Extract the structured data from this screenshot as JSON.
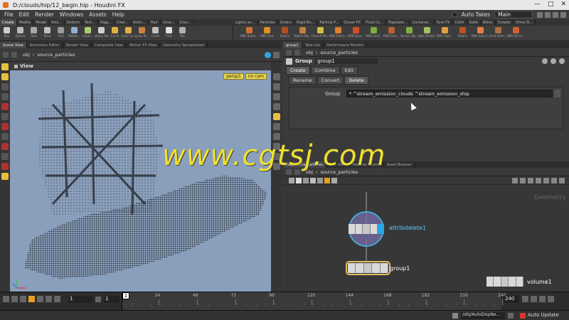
{
  "window": {
    "title": "D:/clouds/hip/12_begin.hip - Houdini FX",
    "controls": [
      "—",
      "□",
      "✕"
    ]
  },
  "menu": {
    "items": [
      "File",
      "Edit",
      "Render",
      "Windows",
      "Assets",
      "Help"
    ],
    "auto_takes": "Auto Takes",
    "desktop": "Main"
  },
  "shelf_tabs_left": [
    "Create",
    "Modify",
    "Model",
    "Poly...",
    "Deform",
    "Text...",
    "Rigg...",
    "Char...",
    "Anim...",
    "Hair",
    "Groo...",
    "Clou..."
  ],
  "shelf_tabs_right": [
    "Lights an...",
    "Particles",
    "Grains",
    "Rigid Bo...",
    "Particle F...",
    "Ocean FX",
    "Fluid Co...",
    "Populate...",
    "Containe...",
    "Pyro FX",
    "Cloth",
    "Solid",
    "Wires",
    "Crowds",
    "Drive Si..."
  ],
  "shelf_tools_left": [
    "Box",
    "Sphere",
    "Tube",
    "Torus",
    "Grid",
    "Metab...",
    "LSyst...",
    "Platonic Sol...",
    "Curve",
    "Draw Cur...",
    "Spray Pa...",
    "Circle",
    "Font",
    "File"
  ],
  "shelf_tools_right": [
    "RBD Bullet...",
    "RBD Glue",
    "Debris",
    "Debris Obj...",
    "Ground Pla...",
    "RBD Fractu...",
    "RBD Glue...",
    "RBD Conf...",
    "RBD Grav...",
    "Terrain Obj...",
    "Make Breakt...",
    "RBD Impa...",
    "Debris",
    "RBD Auto F...",
    "Unst Anim...",
    "RBD Fill Co..."
  ],
  "left_pane": {
    "tabs": [
      "Scene View",
      "Animation Editor",
      "Render View",
      "Composite View",
      "Motion FX View",
      "Geometry Spreadsheet"
    ],
    "path": [
      "obj",
      "source_particles"
    ],
    "view_title": "View",
    "camera": "persp1",
    "cam_select": "no cam"
  },
  "param_pane": {
    "tabs": [
      "group1",
      "Take List",
      "Performance Monitor"
    ],
    "path": [
      "obj",
      "source_particles"
    ],
    "node_type": "Group",
    "node_name": "group1",
    "section_tabs": [
      "Create",
      "Combine",
      "Edit"
    ],
    "sub_tabs": [
      "Rename",
      "Convert",
      "Delete"
    ],
    "group_label": "Group",
    "group_value": "* ^stream_emission_clouds ^stream_emission_ship"
  },
  "net_pane": {
    "tabs": [
      "/obj/source_particles",
      "Tree View",
      "Material Palette",
      "Asset Browser"
    ],
    "path": [
      "obj",
      "source_particles"
    ],
    "context_label": "Geometry",
    "nodes": [
      {
        "name": "attribdelete1"
      },
      {
        "name": "group1"
      },
      {
        "name": "volume1"
      }
    ]
  },
  "watermark": "www.cgtsj.com",
  "timeline": {
    "ticks": [
      "1",
      "24",
      "48",
      "72",
      "96",
      "120",
      "144",
      "168",
      "192",
      "216",
      "240"
    ],
    "current_frame": "1",
    "start_frame": "1",
    "start_value": "1",
    "end_frame": "240",
    "end_value": "240"
  },
  "status": {
    "path": "/obj/AutoDopNe...",
    "update_mode": "Auto Update"
  },
  "colors": {
    "accent_blue": "#2aa6e6",
    "node_select": "#e0c060",
    "viewport_bg": "#8a9fbb"
  }
}
